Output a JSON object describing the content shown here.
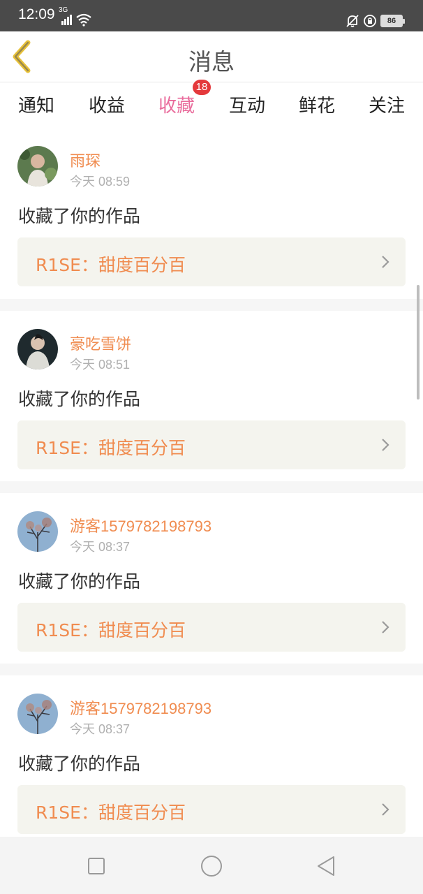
{
  "status_bar": {
    "time": "12:09",
    "network": "3G",
    "battery": "86",
    "icons": [
      "signal-icon",
      "wifi-icon",
      "mute-icon",
      "rotation-lock-icon",
      "battery-icon"
    ]
  },
  "header": {
    "title": "消息",
    "back_icon": "chevron-left-icon"
  },
  "tabs": [
    {
      "label": "通知",
      "active": false
    },
    {
      "label": "收益",
      "active": false
    },
    {
      "label": "收藏",
      "active": true,
      "badge": "18"
    },
    {
      "label": "互动",
      "active": false
    },
    {
      "label": "鲜花",
      "active": false
    },
    {
      "label": "关注",
      "active": false
    }
  ],
  "messages": [
    {
      "username": "雨琛",
      "time": "今天 08:59",
      "action": "收藏了你的作品",
      "work_title": "R1SE：甜度百分百"
    },
    {
      "username": "豪吃雪饼",
      "time": "今天 08:51",
      "action": "收藏了你的作品",
      "work_title": "R1SE：甜度百分百"
    },
    {
      "username": "游客1579782198793",
      "time": "今天 08:37",
      "action": "收藏了你的作品",
      "work_title": "R1SE：甜度百分百"
    },
    {
      "username": "游客1579782198793",
      "time": "今天 08:37",
      "action": "收藏了你的作品",
      "work_title": "R1SE：甜度百分百"
    }
  ],
  "colors": {
    "accent_pink": "#e96c9c",
    "username_orange": "#f08c50",
    "badge_red": "#e4393c",
    "back_yellow": "#e8c23a"
  },
  "nav_bar": {
    "icons": [
      "recent-apps-icon",
      "home-icon",
      "back-triangle-icon"
    ]
  }
}
